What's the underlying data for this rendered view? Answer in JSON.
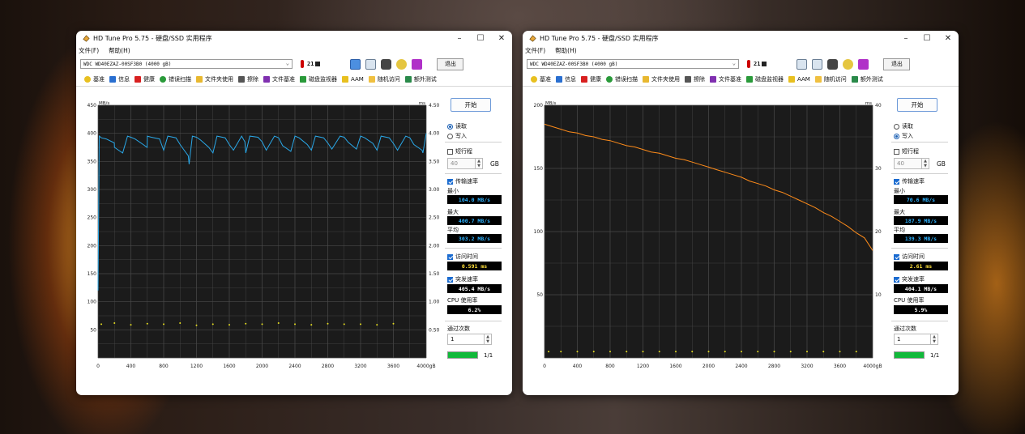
{
  "windows": [
    {
      "title": "HD Tune Pro 5.75 - 硬盘/SSD 实用程序",
      "menu": [
        "文件(F)",
        "帮助(H)"
      ],
      "drive": "WDC WD40EZAZ-00SF3B0 (4000 gB)",
      "temperature": "21",
      "exit_label": "退出",
      "tabs": [
        "基准",
        "信息",
        "健康",
        "错误扫描",
        "文件夹使用",
        "擦除",
        "文件基准",
        "磁盘监视器",
        "AAM",
        "随机访问",
        "额外测试"
      ],
      "start_label": "开始",
      "mode_read": "读取",
      "mode_write": "写入",
      "mode_selected": "read",
      "short_stroke": "短行程",
      "short_stroke_value": "40",
      "short_stroke_unit": "GB",
      "transfer_rate_label": "传输速率",
      "min_label": "最小",
      "min_value": "104.0 MB/s",
      "max_label": "最大",
      "max_value": "400.7 MB/s",
      "avg_label": "平均",
      "avg_value": "303.2 MB/s",
      "access_time_label": "访问时间",
      "access_time_value": "0.591 ms",
      "burst_rate_label": "突发速率",
      "burst_rate_value": "405.4 MB/s",
      "cpu_label": "CPU 使用率",
      "cpu_value": "6.2%",
      "pass_label": "通过次数",
      "pass_value": "1",
      "progress_text": "1/1",
      "progress_fraction": 1.0
    },
    {
      "title": "HD Tune Pro 5.75 - 硬盘/SSD 实用程序",
      "menu": [
        "文件(F)",
        "帮助(H)"
      ],
      "drive": "WDC WD40EZAZ-00SF3B0 (4000 gB)",
      "temperature": "21",
      "exit_label": "退出",
      "tabs": [
        "基准",
        "信息",
        "健康",
        "错误扫描",
        "文件夹使用",
        "擦除",
        "文件基准",
        "磁盘监视器",
        "AAM",
        "随机访问",
        "额外测试"
      ],
      "start_label": "开始",
      "mode_read": "读取",
      "mode_write": "写入",
      "mode_selected": "write",
      "short_stroke": "短行程",
      "short_stroke_value": "40",
      "short_stroke_unit": "GB",
      "transfer_rate_label": "传输速率",
      "min_label": "最小",
      "min_value": "70.6 MB/s",
      "max_label": "最大",
      "max_value": "187.9 MB/s",
      "avg_label": "平均",
      "avg_value": "139.3 MB/s",
      "access_time_label": "访问时间",
      "access_time_value": "2.61 ms",
      "burst_rate_label": "突发速率",
      "burst_rate_value": "404.1 MB/s",
      "cpu_label": "CPU 使用率",
      "cpu_value": "5.9%",
      "pass_label": "通过次数",
      "pass_value": "1",
      "progress_text": "1/1",
      "progress_fraction": 1.0
    }
  ],
  "chart_data": [
    {
      "type": "line",
      "ylabel_left": "MB/s",
      "ylabel_right": "ms",
      "xlim": [
        0,
        4000
      ],
      "ylim": [
        0,
        450
      ],
      "y2lim": [
        0,
        4.5
      ],
      "x_ticks": [
        "0",
        "400",
        "800",
        "1200",
        "1600",
        "2000",
        "2400",
        "2800",
        "3200",
        "3600",
        "4000gB"
      ],
      "y_ticks": [
        "50",
        "100",
        "150",
        "200",
        "250",
        "300",
        "350",
        "400",
        "450"
      ],
      "y2_ticks": [
        "0.50",
        "1.00",
        "1.50",
        "2.00",
        "2.50",
        "3.00",
        "3.50",
        "4.00",
        "4.50"
      ],
      "grid": true,
      "series": [
        {
          "color": "#2aa8e8",
          "x": [
            0,
            15,
            40,
            100,
            199,
            200,
            250,
            300,
            360,
            400,
            450,
            550,
            599,
            600,
            650,
            750,
            800,
            850,
            950,
            1000,
            1050,
            1100,
            1110,
            1150,
            1200,
            1250,
            1350,
            1400,
            1450,
            1550,
            1600,
            1650,
            1750,
            1790,
            1800,
            1850,
            1950,
            2000,
            2050,
            2150,
            2200,
            2250,
            2350,
            2400,
            2450,
            2550,
            2600,
            2650,
            2750,
            2800,
            2850,
            2950,
            3000,
            3050,
            3150,
            3200,
            3250,
            3350,
            3400,
            3450,
            3550,
            3600,
            3650,
            3750,
            3800,
            3850,
            3950,
            3960,
            4000
          ],
          "y": [
            120,
            395,
            392,
            390,
            383,
            375,
            370,
            365,
            395,
            393,
            390,
            380,
            375,
            395,
            393,
            390,
            370,
            395,
            392,
            380,
            370,
            360,
            345,
            395,
            393,
            388,
            375,
            365,
            395,
            392,
            380,
            370,
            395,
            385,
            365,
            395,
            393,
            385,
            370,
            395,
            392,
            378,
            368,
            395,
            392,
            380,
            370,
            395,
            392,
            383,
            372,
            395,
            393,
            384,
            372,
            395,
            392,
            382,
            370,
            395,
            392,
            382,
            370,
            395,
            392,
            380,
            370,
            365,
            400
          ]
        },
        {
          "color": "#e8e020",
          "type": "scatter",
          "axis": "right",
          "x": [
            40,
            200,
            400,
            600,
            800,
            1000,
            1200,
            1400,
            1600,
            1800,
            2000,
            2200,
            2400,
            2600,
            2800,
            3000,
            3200,
            3400,
            3600
          ],
          "y": [
            0.6,
            0.62,
            0.59,
            0.61,
            0.6,
            0.62,
            0.58,
            0.6,
            0.59,
            0.61,
            0.6,
            0.62,
            0.6,
            0.59,
            0.61,
            0.6,
            0.6,
            0.59,
            0.61
          ]
        }
      ]
    },
    {
      "type": "line",
      "ylabel_left": "MB/s",
      "ylabel_right": "ms",
      "xlim": [
        0,
        4000
      ],
      "ylim": [
        0,
        200
      ],
      "y2lim": [
        0,
        40
      ],
      "x_ticks": [
        "0",
        "400",
        "800",
        "1200",
        "1600",
        "2000",
        "2400",
        "2800",
        "3200",
        "3600",
        "4000gB"
      ],
      "y_ticks": [
        "50",
        "100",
        "150",
        "200"
      ],
      "y2_ticks": [
        "10",
        "20",
        "30",
        "40"
      ],
      "grid": true,
      "series": [
        {
          "color": "#ff8c1a",
          "x": [
            0,
            100,
            200,
            300,
            400,
            500,
            600,
            700,
            800,
            900,
            1000,
            1100,
            1200,
            1300,
            1400,
            1500,
            1600,
            1700,
            1800,
            1900,
            2000,
            2100,
            2200,
            2300,
            2400,
            2500,
            2600,
            2700,
            2800,
            2900,
            3000,
            3100,
            3200,
            3300,
            3400,
            3500,
            3600,
            3700,
            3800,
            3900,
            4000
          ],
          "y": [
            185,
            183,
            181,
            179,
            178,
            176,
            175,
            173,
            172,
            170,
            168,
            167,
            165,
            163,
            162,
            160,
            158,
            157,
            155,
            153,
            151,
            149,
            147,
            145,
            143,
            140,
            138,
            136,
            133,
            131,
            128,
            125,
            122,
            119,
            115,
            112,
            108,
            104,
            99,
            95,
            85
          ]
        },
        {
          "color": "#e8e020",
          "type": "scatter",
          "axis": "right",
          "x": [
            50,
            200,
            400,
            600,
            800,
            1000,
            1200,
            1400,
            1600,
            1800,
            2000,
            2200,
            2400,
            2600,
            2800,
            3000,
            3200,
            3400,
            3600,
            3800
          ],
          "y": [
            1,
            1,
            1,
            1,
            1,
            1,
            1,
            1,
            1,
            1,
            1,
            1,
            1,
            1,
            1,
            1,
            1,
            1,
            1,
            1
          ]
        }
      ]
    }
  ],
  "colors": {
    "chart_bg": "#1b1b1b",
    "grid": "#4a4a4a",
    "progress": "#11b93a"
  }
}
